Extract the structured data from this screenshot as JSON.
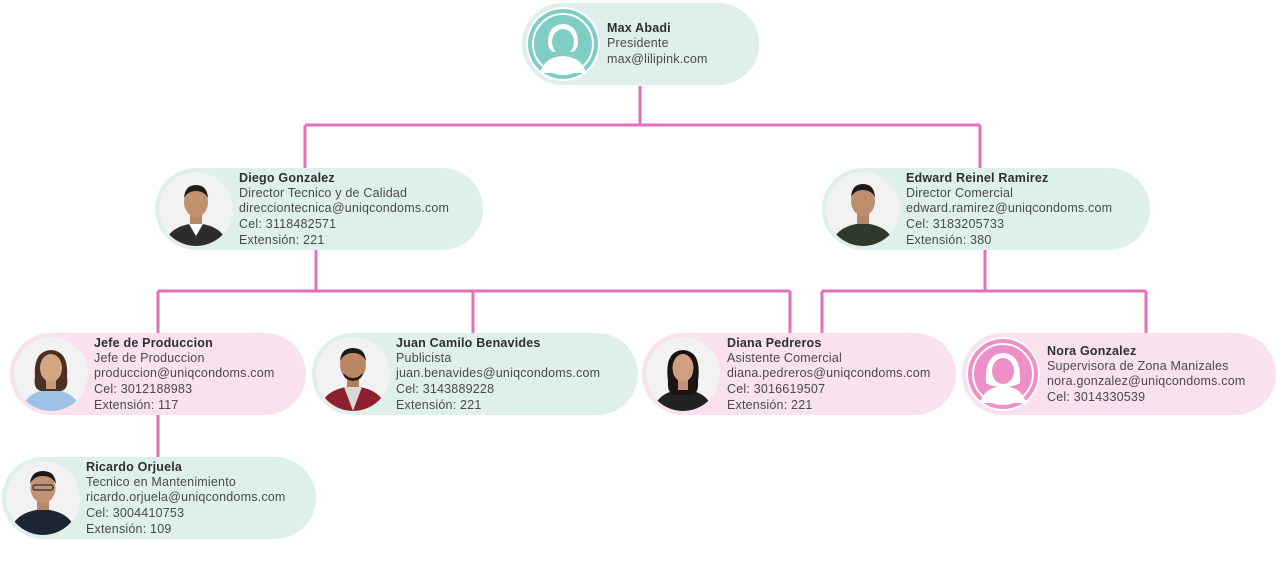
{
  "org": {
    "max": {
      "name": "Max Abadi",
      "role": "Presidente",
      "email": "max@lilipink.com"
    },
    "diego": {
      "name": "Diego Gonzalez",
      "role": "Director Tecnico y de Calidad",
      "email": "direcciontecnica@uniqcondoms.com",
      "phone": "Cel: 3118482571",
      "ext": "Extensión: 221"
    },
    "edward": {
      "name": "Edward Reinel Ramirez",
      "role": "Director Comercial",
      "email": "edward.ramirez@uniqcondoms.com",
      "phone": "Cel: 3183205733",
      "ext": "Extensión: 380"
    },
    "jefe": {
      "name": "Jefe de Produccion",
      "role": "Jefe de Produccion",
      "email": "produccion@uniqcondoms.com",
      "phone": "Cel: 3012188983",
      "ext": "Extensión: 117"
    },
    "juan": {
      "name": "Juan Camilo Benavides",
      "role": "Publicista",
      "email": "juan.benavides@uniqcondoms.com",
      "phone": "Cel: 3143889228",
      "ext": "Extensión: 221"
    },
    "diana": {
      "name": "Diana Pedreros",
      "role": "Asistente Comercial",
      "email": "diana.pedreros@uniqcondoms.com",
      "phone": "Cel: 3016619507",
      "ext": "Extensión: 221"
    },
    "nora": {
      "name": "Nora Gonzalez",
      "role": "Supervisora de Zona Manizales",
      "email": "nora.gonzalez@uniqcondoms.com",
      "phone": "Cel: 3014330539"
    },
    "ricardo": {
      "name": "Ricardo Orjuela",
      "role": "Tecnico en Mantenimiento",
      "email": "ricardo.orjuela@uniqcondoms.com",
      "phone": "Cel: 3004410753",
      "ext": "Extensión: 109"
    }
  },
  "colors": {
    "connector": "#e56fb8",
    "teal_card": "#dfefec",
    "pink_card": "#f9e1ee",
    "teal_avatar": "#7fcdc3",
    "pink_avatar": "#ee8fc8"
  }
}
